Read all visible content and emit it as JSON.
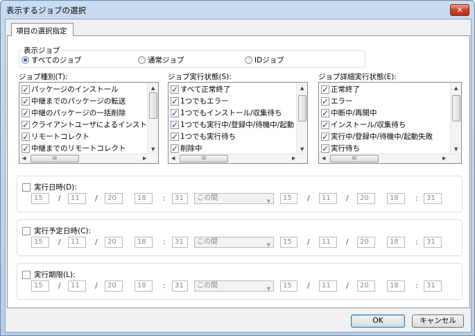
{
  "window": {
    "title": "表示するジョブの選択",
    "close": "✕"
  },
  "tab": {
    "label": "項目の選択指定"
  },
  "display_job": {
    "legend": "表示ジョブ",
    "options": [
      {
        "label": "すべてのジョブ",
        "selected": true
      },
      {
        "label": "通常ジョブ",
        "selected": false
      },
      {
        "label": "IDジョブ",
        "selected": false
      }
    ]
  },
  "lists": [
    {
      "label": "ジョブ種別(T):",
      "items": [
        "パッケージのインストール",
        "中継までのパッケージの転送",
        "中継のパッケージの一括削除",
        "クライアントユーザによるインストール",
        "リモートコレクト",
        "中継までのリモートコレクト"
      ]
    },
    {
      "label": "ジョブ実行状態(S):",
      "items": [
        "すべて正常終了",
        "1つでもエラー",
        "1つでもインストール/収集待ち",
        "1つでも実行中/登録中/待機中/起動",
        "1つでも実行待ち",
        "削除中"
      ]
    },
    {
      "label": "ジョブ詳細実行状態(E):",
      "items": [
        "正常終了",
        "エラー",
        "中断中/再開中",
        "インストール/収集待ち",
        "実行中/登録中/待機中/起動失敗",
        "実行待ち"
      ]
    }
  ],
  "date_groups": [
    {
      "label": "実行日時(D):",
      "checked": false,
      "from": [
        "15",
        "11",
        "20",
        "18",
        "31"
      ],
      "mode": "この間",
      "to": [
        "15",
        "11",
        "20",
        "18",
        "31"
      ]
    },
    {
      "label": "実行予定日時(C):",
      "checked": false,
      "from": [
        "15",
        "11",
        "20",
        "18",
        "31"
      ],
      "mode": "この間",
      "to": [
        "15",
        "11",
        "20",
        "18",
        "31"
      ]
    },
    {
      "label": "実行期限(L):",
      "checked": false,
      "from": [
        "15",
        "11",
        "20",
        "18",
        "31"
      ],
      "mode": "この間",
      "to": [
        "15",
        "11",
        "20",
        "18",
        "31"
      ]
    }
  ],
  "separators": {
    "date": "/",
    "time": ":"
  },
  "buttons": {
    "ok": "OK",
    "cancel": "キャンセル"
  }
}
